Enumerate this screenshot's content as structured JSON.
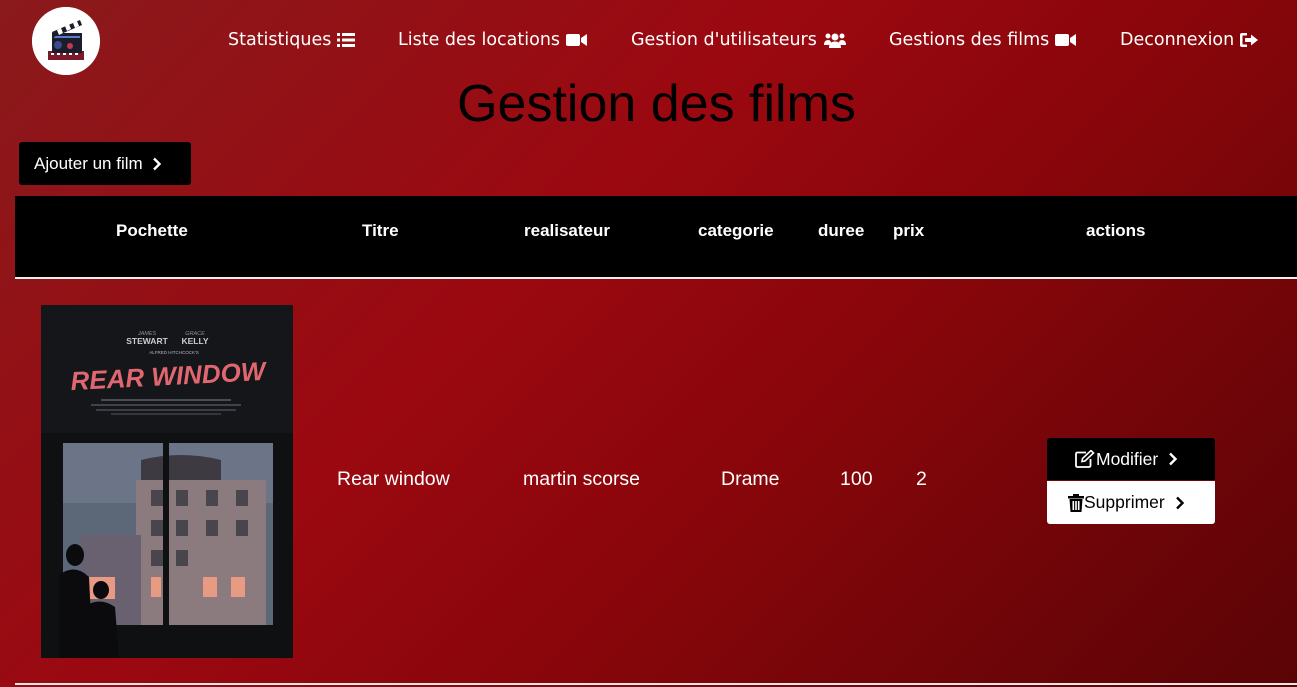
{
  "nav": {
    "items": [
      {
        "label": "Statistiques",
        "icon": "list-icon"
      },
      {
        "label": "Liste des locations",
        "icon": "video-camera-icon"
      },
      {
        "label": "Gestion d'utilisateurs",
        "icon": "users-icon"
      },
      {
        "label": "Gestions des films",
        "icon": "video-camera-icon"
      },
      {
        "label": "Deconnexion",
        "icon": "sign-out-icon"
      }
    ]
  },
  "page": {
    "title": "Gestion des films",
    "add_button": "Ajouter un film"
  },
  "table": {
    "headers": [
      "Pochette",
      "Titre",
      "realisateur",
      "categorie",
      "duree",
      "prix",
      "actions"
    ],
    "rows": [
      {
        "poster": {
          "actor1_first": "JAMES",
          "actor1": "STEWART",
          "actor2_first": "GRACE",
          "actor2": "KELLY",
          "presenter": "ALFRED HITCHCOCK'S",
          "title": "REAR WINDOW"
        },
        "titre": "Rear window",
        "realisateur": "martin scorse",
        "categorie": "Drame",
        "duree": "100",
        "prix": "2",
        "actions": {
          "modify": "Modifier",
          "delete": "Supprimer"
        }
      }
    ]
  },
  "colors": {
    "background_red": "#9b0810",
    "black": "#000000",
    "poster_title": "#e06670"
  }
}
